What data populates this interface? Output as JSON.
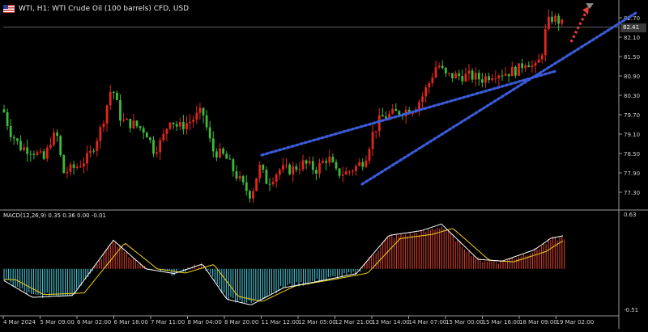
{
  "header": {
    "flag_icon": "us-flag-icon",
    "title": "WTI, H1:  WTI Crude Oil (100 barrels) CFD, USD"
  },
  "macd": {
    "label": "MACD(12,26,9) 0.35 0.36 0.00 -0.01"
  },
  "price_tag": "82.41",
  "colors": {
    "background": "#000000",
    "bull": "#e3261d",
    "bear": "#3bbb3b",
    "trend": "#3b5bdb",
    "arrow": "#e23b3b",
    "macd_line": "#ffffff",
    "signal_line": "#f2d21b",
    "hist_pos": "#c0392b",
    "hist_neg": "#45b3c2"
  },
  "chart_data": {
    "type": "candlestick",
    "symbol": "WTI",
    "timeframe": "H1",
    "price_axis": {
      "labels": [
        "82.70",
        "82.10",
        "81.50",
        "80.90",
        "80.30",
        "79.70",
        "79.10",
        "78.50",
        "77.90",
        "77.30"
      ],
      "ylim": [
        76.8,
        83.1
      ]
    },
    "macd_axis": {
      "labels": [
        "0.63",
        "-0.51"
      ],
      "ylim": [
        -0.51,
        0.63
      ]
    },
    "time_axis": {
      "labels": [
        "4 Mar 2024",
        "5 Mar 09:00",
        "6 Mar 02:00",
        "6 Mar 18:00",
        "7 Mar 11:00",
        "8 Mar 04:00",
        "8 Mar 20:00",
        "11 Mar 12:00",
        "12 Mar 05:00",
        "12 Mar 21:00",
        "13 Mar 14:00",
        "14 Mar 07:00",
        "15 Mar 00:00",
        "15 Mar 16:00",
        "18 Mar 09:00",
        "19 Mar 02:00"
      ]
    },
    "price_path": [
      [
        0,
        80.2
      ],
      [
        12,
        79.2
      ],
      [
        25,
        78.7
      ],
      [
        40,
        78.6
      ],
      [
        55,
        78.3
      ],
      [
        62,
        78.9
      ],
      [
        70,
        79.1
      ],
      [
        78,
        77.9
      ],
      [
        95,
        78.1
      ],
      [
        110,
        78.4
      ],
      [
        125,
        79.3
      ],
      [
        138,
        80.6
      ],
      [
        150,
        79.5
      ],
      [
        165,
        79.4
      ],
      [
        180,
        79.2
      ],
      [
        190,
        78.6
      ],
      [
        200,
        78.9
      ],
      [
        210,
        79.6
      ],
      [
        220,
        79.3
      ],
      [
        235,
        79.5
      ],
      [
        250,
        79.8
      ],
      [
        262,
        78.6
      ],
      [
        278,
        78.4
      ],
      [
        290,
        77.9
      ],
      [
        300,
        77.5
      ],
      [
        310,
        77.2
      ],
      [
        320,
        78.1
      ],
      [
        330,
        77.6
      ],
      [
        345,
        78.0
      ],
      [
        360,
        78.0
      ],
      [
        375,
        78.2
      ],
      [
        390,
        78.0
      ],
      [
        405,
        78.4
      ],
      [
        415,
        77.9
      ],
      [
        428,
        77.9
      ],
      [
        440,
        78.1
      ],
      [
        450,
        78.3
      ],
      [
        460,
        79.1
      ],
      [
        470,
        79.6
      ],
      [
        482,
        79.7
      ],
      [
        495,
        79.8
      ],
      [
        510,
        79.9
      ],
      [
        520,
        80.2
      ],
      [
        530,
        80.7
      ],
      [
        540,
        81.3
      ],
      [
        550,
        80.9
      ],
      [
        565,
        80.9
      ],
      [
        580,
        80.9
      ],
      [
        595,
        80.8
      ],
      [
        610,
        81.0
      ],
      [
        625,
        81.0
      ],
      [
        640,
        81.1
      ],
      [
        650,
        81.4
      ],
      [
        660,
        81.1
      ],
      [
        668,
        81.5
      ],
      [
        675,
        82.5
      ],
      [
        682,
        82.7
      ],
      [
        690,
        82.6
      ],
      [
        697,
        82.41
      ]
    ],
    "macd_path": [
      [
        0,
        -0.1
      ],
      [
        40,
        -0.3
      ],
      [
        90,
        -0.28
      ],
      [
        140,
        0.3
      ],
      [
        180,
        0.0
      ],
      [
        215,
        -0.05
      ],
      [
        250,
        0.05
      ],
      [
        280,
        -0.32
      ],
      [
        310,
        -0.38
      ],
      [
        350,
        -0.2
      ],
      [
        400,
        -0.12
      ],
      [
        440,
        -0.05
      ],
      [
        480,
        0.35
      ],
      [
        520,
        0.4
      ],
      [
        545,
        0.47
      ],
      [
        590,
        0.1
      ],
      [
        620,
        0.08
      ],
      [
        660,
        0.2
      ],
      [
        680,
        0.32
      ],
      [
        697,
        0.35
      ]
    ],
    "trendlines": [
      {
        "from": [
          447,
          77.55
        ],
        "to": [
          785,
          82.85
        ]
      },
      {
        "from": [
          323,
          78.45
        ],
        "to": [
          686,
          81.05
        ]
      }
    ],
    "projection_arrow": {
      "from": [
        705,
        81.95
      ],
      "to": [
        727,
        83.05
      ]
    }
  }
}
